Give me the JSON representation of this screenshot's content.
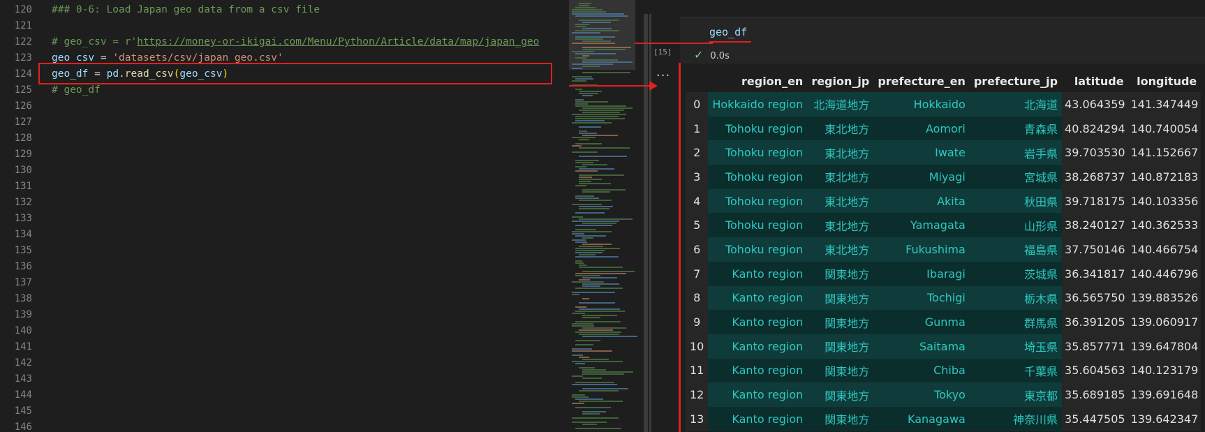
{
  "editor": {
    "line_numbers": [
      "120",
      "121",
      "122",
      "123",
      "124",
      "125",
      "126",
      "127",
      "128",
      "129",
      "130",
      "131",
      "132",
      "133",
      "134",
      "135",
      "136",
      "137",
      "138",
      "139",
      "140",
      "141",
      "142",
      "143",
      "144",
      "145",
      "146"
    ],
    "line120": "### 0-6: Load Japan geo data from a csv file",
    "line122_prefix": "# geo_csv = r'",
    "line122_url": "https://money-or-ikigai.com/Menu/Python/Article/data/map/japan_geo",
    "line123_var": "geo_csv",
    "line123_eq": " = ",
    "line123_str": "'datasets/csv/japan_geo.csv'",
    "line124_var": "geo_df",
    "line124_eq": " = ",
    "line124_mod": "pd",
    "line124_dot": ".",
    "line124_fn": "read_csv",
    "line124_open": "(",
    "line124_arg": "geo_csv",
    "line124_close": ")",
    "line125": "# geo_df"
  },
  "cell": {
    "input_code": "geo_df",
    "exec_count": "[15]",
    "status_time": "0.0s",
    "more": "···"
  },
  "table": {
    "columns": [
      "",
      "region_en",
      "region_jp",
      "prefecture_en",
      "prefecture_jp",
      "latitude",
      "longitude"
    ],
    "rows": [
      [
        "0",
        "Hokkaido region",
        "北海道地方",
        "Hokkaido",
        "北海道",
        "43.064359",
        "141.347449"
      ],
      [
        "1",
        "Tohoku region",
        "東北地方",
        "Aomori",
        "青森県",
        "40.824294",
        "140.740054"
      ],
      [
        "2",
        "Tohoku region",
        "東北地方",
        "Iwate",
        "岩手県",
        "39.703530",
        "141.152667"
      ],
      [
        "3",
        "Tohoku region",
        "東北地方",
        "Miyagi",
        "宮城県",
        "38.268737",
        "140.872183"
      ],
      [
        "4",
        "Tohoku region",
        "東北地方",
        "Akita",
        "秋田県",
        "39.718175",
        "140.103356"
      ],
      [
        "5",
        "Tohoku region",
        "東北地方",
        "Yamagata",
        "山形県",
        "38.240127",
        "140.362533"
      ],
      [
        "6",
        "Tohoku region",
        "東北地方",
        "Fukushima",
        "福島県",
        "37.750146",
        "140.466754"
      ],
      [
        "7",
        "Kanto region",
        "関東地方",
        "Ibaragi",
        "茨城県",
        "36.341817",
        "140.446796"
      ],
      [
        "8",
        "Kanto region",
        "関東地方",
        "Tochigi",
        "栃木県",
        "36.565750",
        "139.883526"
      ],
      [
        "9",
        "Kanto region",
        "関東地方",
        "Gunma",
        "群馬県",
        "36.391205",
        "139.060917"
      ],
      [
        "10",
        "Kanto region",
        "関東地方",
        "Saitama",
        "埼玉県",
        "35.857771",
        "139.647804"
      ],
      [
        "11",
        "Kanto region",
        "関東地方",
        "Chiba",
        "千葉県",
        "35.604563",
        "140.123179"
      ],
      [
        "12",
        "Kanto region",
        "関東地方",
        "Tokyo",
        "東京都",
        "35.689185",
        "139.691648"
      ],
      [
        "13",
        "Kanto region",
        "関東地方",
        "Kanagawa",
        "神奈川県",
        "35.447505",
        "139.642347"
      ]
    ]
  },
  "colors": {
    "highlight": "#e02020",
    "text_cell": "#2ec8c0",
    "check": "#89d185"
  }
}
